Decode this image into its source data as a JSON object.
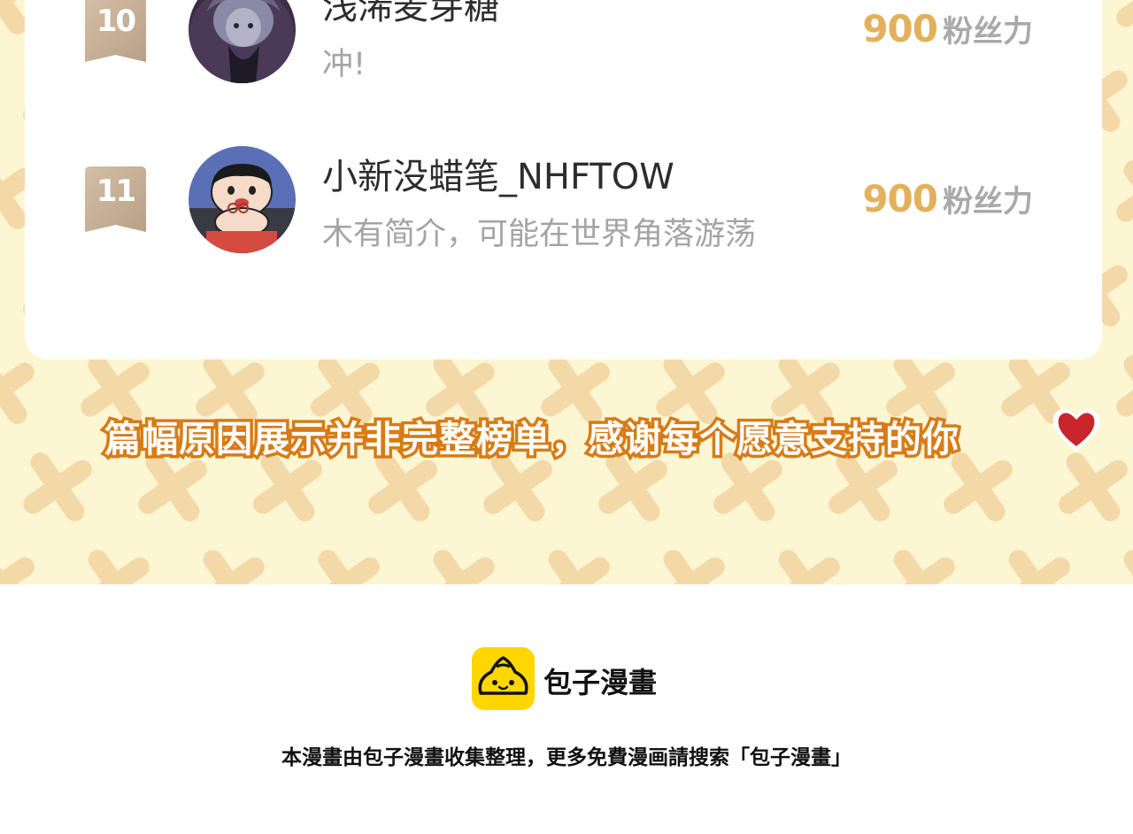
{
  "ranking": {
    "entries": [
      {
        "rank": "10",
        "name": "浅浠麦芽糖",
        "bio": "冲!",
        "score": "900",
        "unit": "粉丝力"
      },
      {
        "rank": "11",
        "name": "小新没蜡笔_NHFTOW",
        "bio": "木有简介，可能在世界角落游荡",
        "score": "900",
        "unit": "粉丝力"
      }
    ]
  },
  "notice": {
    "text": "篇幅原因展示并非完整榜单，感谢每个愿意支持的你",
    "icon": "heart-icon"
  },
  "footer": {
    "brand": "包子漫畫",
    "note": "本漫畫由包子漫畫收集整理，更多免費漫画請搜索「包子漫畫」",
    "icon": "bun-logo-icon"
  },
  "colors": {
    "banner_bg": "#fdf6d3",
    "pattern": "#f3d9a8",
    "score": "#e3b15c",
    "notice_outline": "#d77b16",
    "logo_yellow": "#ffd600"
  }
}
